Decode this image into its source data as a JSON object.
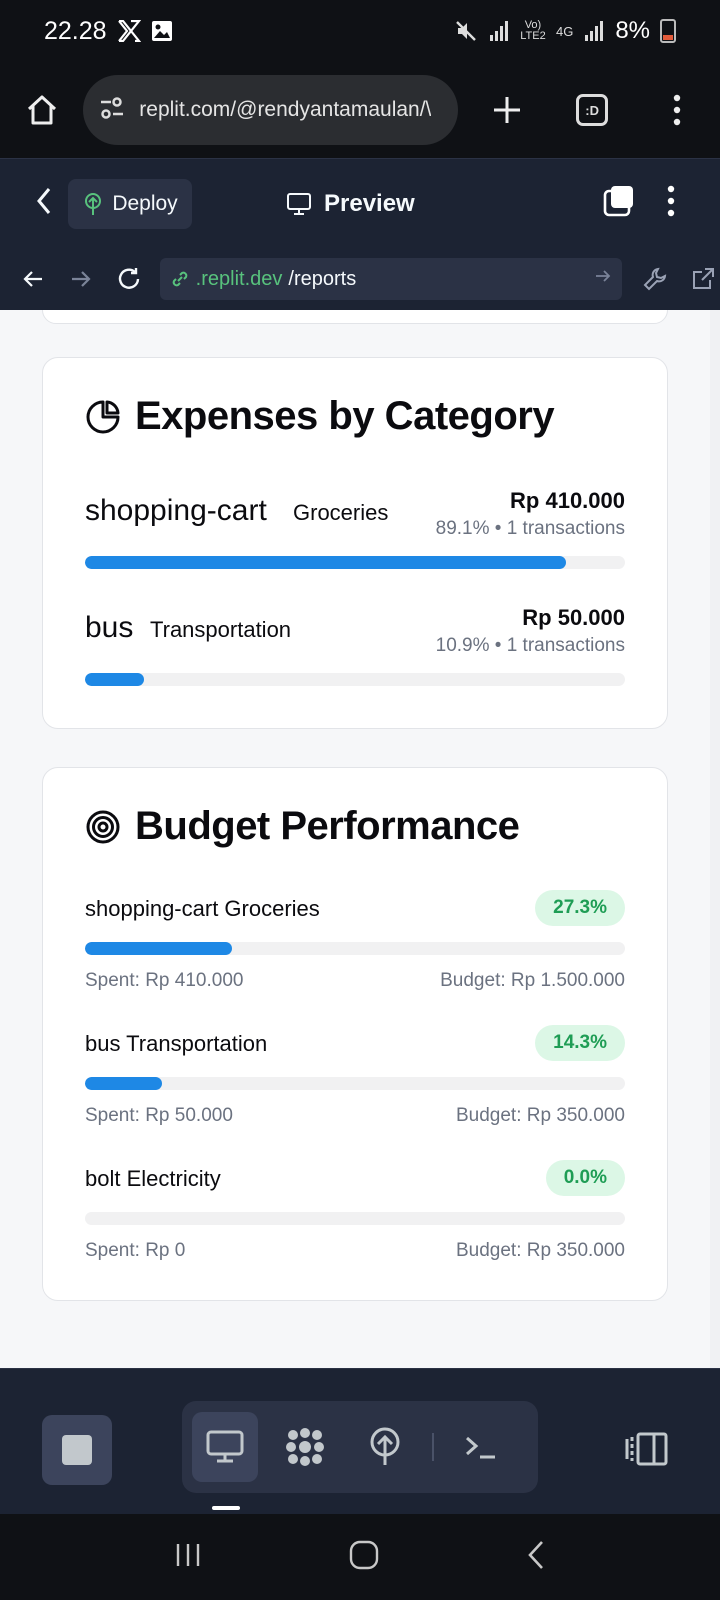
{
  "status_bar": {
    "time": "22.28",
    "battery": "8%",
    "network_label": "Vo) LTE2",
    "network_type": "4G"
  },
  "browser": {
    "url": "replit.com/@rendyantamaulan/\\",
    "tab_count": ":D"
  },
  "replit_header": {
    "deploy_label": "Deploy",
    "preview_label": "Preview"
  },
  "webview": {
    "address_host": ".replit.dev",
    "address_path": "/reports"
  },
  "expenses_card": {
    "title": "Expenses by Category",
    "items": [
      {
        "icon_text": "shopping-cart",
        "name": "Groceries",
        "amount": "Rp 410.000",
        "meta": "89.1% • 1 transactions",
        "fraction": 0.891
      },
      {
        "icon_text": "bus",
        "name": "Transportation",
        "amount": "Rp 50.000",
        "meta": "10.9% • 1 transactions",
        "fraction": 0.109
      }
    ]
  },
  "budget_card": {
    "title": "Budget Performance",
    "items": [
      {
        "label": "shopping-cart Groceries",
        "badge": "27.3%",
        "spent": "Spent: Rp 410.000",
        "budget": "Budget: Rp 1.500.000",
        "fraction": 0.273
      },
      {
        "label": "bus Transportation",
        "badge": "14.3%",
        "spent": "Spent: Rp 50.000",
        "budget": "Budget: Rp 350.000",
        "fraction": 0.143
      },
      {
        "label": "bolt Electricity",
        "badge": "0.0%",
        "spent": "Spent: Rp 0",
        "budget": "Budget: Rp 350.000",
        "fraction": 0.0
      }
    ]
  },
  "colors": {
    "progress_blue": "#1e88e5",
    "badge_green_bg": "#dcf7e6",
    "badge_green_text": "#1f9d55",
    "replit_bg": "#1c2333",
    "host_green": "#58c27d"
  }
}
